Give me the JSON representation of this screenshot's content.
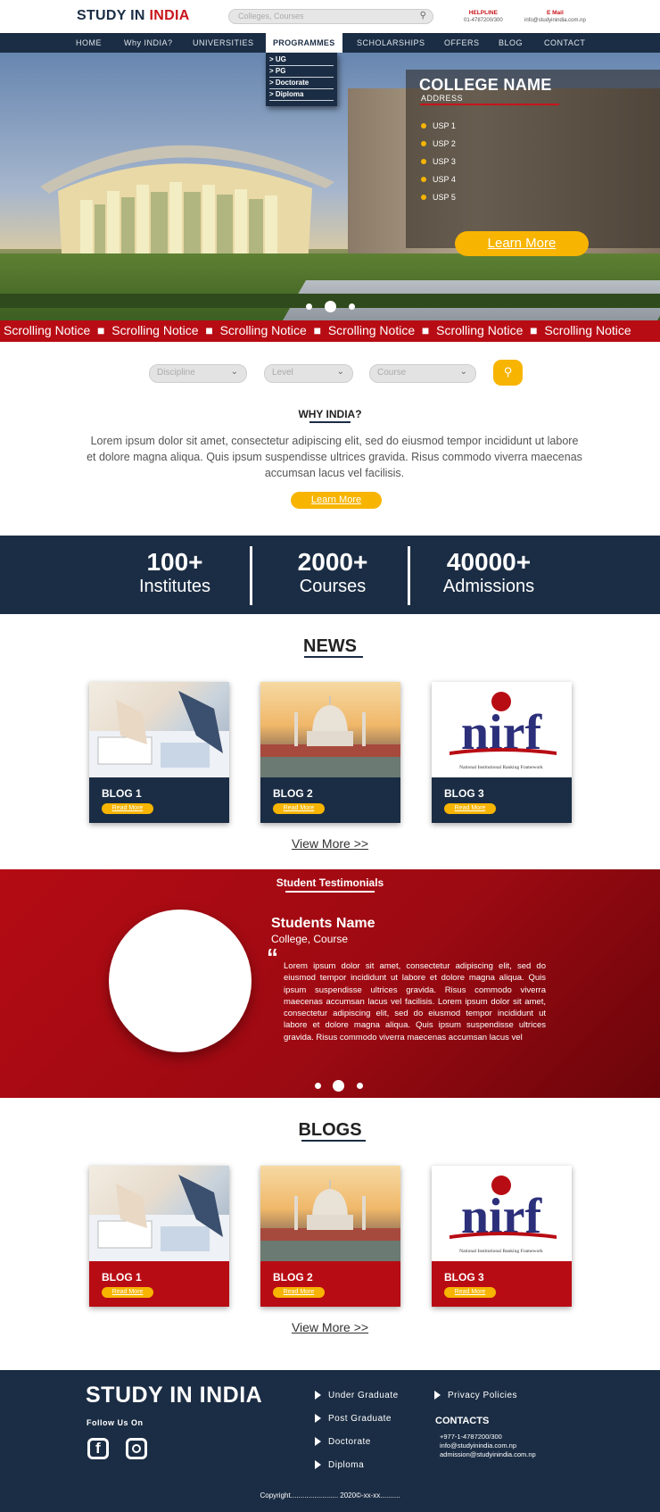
{
  "header": {
    "logo_part1": "STUDY IN ",
    "logo_part2": "INDIA",
    "search_placeholder": "Colleges, Courses",
    "helpline_label": "HELPLINE",
    "helpline_value": "01-4787200/300",
    "email_label": "E Mail",
    "email_value": "info@studyinindia.com.np"
  },
  "nav": {
    "items": [
      "HOME",
      "Why INDIA?",
      "UNIVERSITIES",
      "PROGRAMMES",
      "SCHOLARSHIPS",
      "OFFERS",
      "BLOG",
      "CONTACT"
    ],
    "active": "PROGRAMMES",
    "dropdown": [
      "> UG",
      "> PG",
      "> Doctorate",
      "> Diploma"
    ]
  },
  "hero": {
    "college_name": "COLLEGE NAME",
    "address": "ADDRESS",
    "usps": [
      "USP 1",
      "USP 2",
      "USP 3",
      "USP 4",
      "USP 5"
    ],
    "cta": "Learn More",
    "slide_count": 3,
    "active_slide": 2
  },
  "notice": {
    "items": [
      "Scrolling Notice",
      "Scrolling Notice",
      "Scrolling Notice",
      "Scrolling Notice",
      "Scrolling Notice",
      "Scrolling Notice"
    ]
  },
  "filters": {
    "discipline": "Discipline",
    "level": "Level",
    "course": "Course"
  },
  "why_india": {
    "title": "WHY INDIA?",
    "body": "Lorem ipsum dolor sit amet, consectetur adipiscing elit, sed do eiusmod tempor incididunt ut labore et dolore magna aliqua. Quis ipsum suspendisse ultrices gravida. Risus commodo viverra maecenas accumsan lacus vel facilisis.",
    "cta": "Learn More"
  },
  "stats": [
    {
      "num": "100+",
      "label": "Institutes"
    },
    {
      "num": "2000+",
      "label": "Courses"
    },
    {
      "num": "40000+",
      "label": "Admissions"
    }
  ],
  "news": {
    "title": "NEWS",
    "cards": [
      {
        "title": "BLOG 1",
        "cta": "Read More"
      },
      {
        "title": "BLOG 2",
        "cta": "Read More"
      },
      {
        "title": "BLOG 3",
        "cta": "Read More"
      }
    ],
    "view_more": "View More >>"
  },
  "testimonials": {
    "title": "Student Testimonials",
    "name": "Students Name",
    "course": "College, Course",
    "quote_mark": "“",
    "text": "Lorem ipsum dolor sit amet, consectetur adipiscing elit, sed do eiusmod tempor incididunt ut labore et dolore magna aliqua. Quis ipsum suspendisse ultrices gravida. Risus commodo viverra maecenas accumsan lacus vel facilisis. Lorem ipsum dolor sit amet, consectetur adipiscing elit, sed do eiusmod tempor incididunt ut labore et dolore magna aliqua. Quis ipsum suspendisse ultrices gravida. Risus commodo viverra maecenas accumsan lacus vel",
    "slide_count": 3,
    "active_slide": 2
  },
  "blogs": {
    "title": "BLOGS",
    "cards": [
      {
        "title": "BLOG 1",
        "cta": "Read More"
      },
      {
        "title": "BLOG 2",
        "cta": "Read More"
      },
      {
        "title": "BLOG 3",
        "cta": "Read More"
      }
    ],
    "view_more": "View More >>"
  },
  "nirf": {
    "logo_text": "nirf",
    "caption": "National Institutional Ranking Framework"
  },
  "footer": {
    "logo": "STUDY IN INDIA",
    "follow": "Follow Us On",
    "links": [
      "Under Graduate",
      "Post Graduate",
      "Doctorate",
      "Diploma"
    ],
    "privacy": "Privacy Policies",
    "contacts_title": "CONTACTS",
    "contacts": [
      "+977-1-4787200/300",
      "info@studyinindia.com.np",
      "admission@studyinindia.com.np"
    ],
    "copyright": "Copyright........................ 2020©-xx-xx.........."
  },
  "colors": {
    "navy": "#1b2d44",
    "red": "#b80c14",
    "accent": "#f7b400"
  }
}
